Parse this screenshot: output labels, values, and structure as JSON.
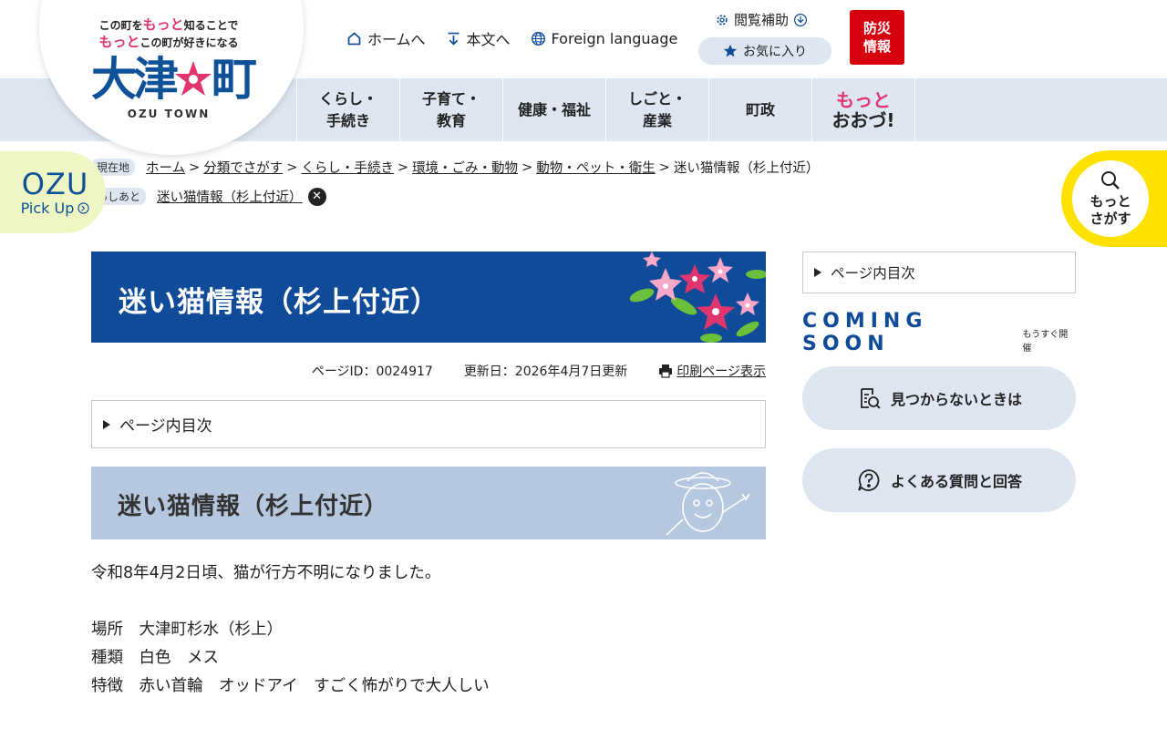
{
  "logo": {
    "tagline_line1_pre": "この町を",
    "tagline_line1_em": "もっと",
    "tagline_line1_post": "知ることで",
    "tagline_line2_em": "もっと",
    "tagline_line2_post": "この町が好きになる",
    "name_part1": "大津",
    "name_part2": "町",
    "sub": "OZU TOWN"
  },
  "top_links": [
    {
      "label": "ホームへ",
      "icon": "home-icon"
    },
    {
      "label": "本文へ",
      "icon": "arrow-down-icon"
    },
    {
      "label": "Foreign language",
      "icon": "globe-icon"
    }
  ],
  "accessibility_label": "閲覧補助",
  "favorites_label": "お気に入り",
  "disaster": {
    "line1": "防災",
    "line2": "情報"
  },
  "gnav": [
    {
      "line1": "くらし・",
      "line2": "手続き"
    },
    {
      "line1": "子育て・",
      "line2": "教育"
    },
    {
      "line1": "健康・福祉",
      "line2": ""
    },
    {
      "line1": "しごと・",
      "line2": "産業"
    },
    {
      "line1": "町政",
      "line2": ""
    }
  ],
  "gnav_special": {
    "line1": "もっと",
    "line2": "おおづ!"
  },
  "pickup": {
    "title": "OZU",
    "sub": "Pick Up"
  },
  "search_btn": {
    "line1": "もっと",
    "line2": "さがす"
  },
  "breadcrumb": {
    "badge": "現在地",
    "items": [
      "ホーム",
      "分類でさがす",
      "くらし・手続き",
      "環境・ごみ・動物",
      "動物・ペット・衛生"
    ],
    "current": "迷い猫情報（杉上付近）",
    "separator": ">"
  },
  "history": {
    "badge": "あしあと",
    "item": "迷い猫情報（杉上付近）"
  },
  "page": {
    "title": "迷い猫情報（杉上付近）",
    "page_id": "ページID：0024917",
    "updated": "更新日：2026年4月7日更新",
    "print": "印刷ページ表示",
    "toc": "ページ内目次",
    "h2": "迷い猫情報（杉上付近）",
    "lead": "令和8年4月2日頃、猫が行方不明になりました。",
    "details": [
      "場所　大津町杉水（杉上）",
      "種類　白色　メス",
      "特徴　赤い首輪　オッドアイ　すごく怖がりで大人しい"
    ]
  },
  "side": {
    "toc": "ページ内目次",
    "coming_soon": "COMING SOON",
    "coming_soon_sub": "もうすぐ開催",
    "not_found": "見つからないときは",
    "faq": "よくある質問と回答"
  },
  "colors": {
    "primary": "#0f4b99",
    "light": "#dde6f1",
    "band": "#b5c8e0",
    "pink": "#e0356f",
    "red": "#d7000f",
    "yellow": "#ffe100",
    "green": "#eef7c4"
  }
}
